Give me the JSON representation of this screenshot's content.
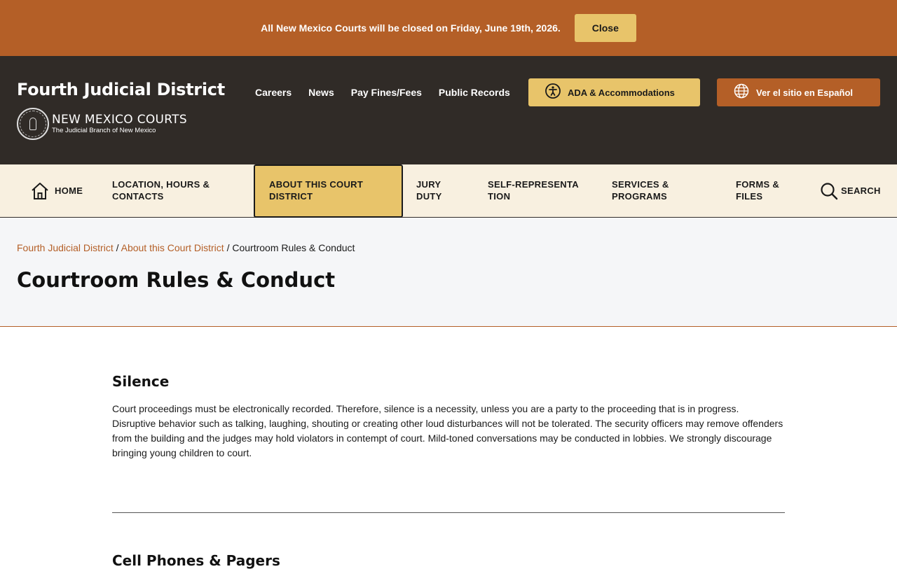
{
  "alert": {
    "message": "All New Mexico Courts will be closed on Friday, June 19th, 2026.",
    "close_label": "Close"
  },
  "header": {
    "site_title": "Fourth Judicial District",
    "logo": {
      "name": "NEW MEXICO COURTS",
      "tagline": "The Judicial Branch of New Mexico"
    },
    "utility_links": [
      "Careers",
      "News",
      "Pay Fines/Fees",
      "Public Records"
    ],
    "ada_label": "ADA & Accommodations",
    "spanish_label": "Ver el sitio en Español"
  },
  "nav": {
    "items": [
      {
        "label": "HOME"
      },
      {
        "label": "LOCATION, HOURS & CONTACTS"
      },
      {
        "label": "ABOUT THIS COURT DISTRICT"
      },
      {
        "label": "JURY DUTY"
      },
      {
        "label": "SELF-REPRESENTATION"
      },
      {
        "label": "SERVICES & PROGRAMS"
      },
      {
        "label": "FORMS & FILES"
      },
      {
        "label": "SEARCH"
      }
    ],
    "active_index": 2
  },
  "breadcrumb": {
    "items": [
      "Fourth Judicial District",
      "About this Court District"
    ],
    "current": "Courtroom Rules & Conduct",
    "separator": "/"
  },
  "page_title": "Courtroom Rules & Conduct",
  "sections": [
    {
      "heading": "Silence",
      "body": "Court proceedings must be electronically recorded. Therefore, silence is a necessity, unless you are a party to the proceeding that is in progress. Disruptive behavior such as talking, laughing, shouting or creating other loud disturbances will not be tolerated. The security officers may remove offenders from the building and the judges may hold violators in contempt of court. Mild-toned conversations may be conducted in lobbies. We strongly discourage bringing young children to court."
    },
    {
      "heading": "Cell Phones & Pagers"
    }
  ],
  "colors": {
    "brand_rust": "#b45f27",
    "accent_gold": "#e8c46a",
    "header_dark": "#302b27",
    "nav_cream": "#f8f0e0"
  }
}
